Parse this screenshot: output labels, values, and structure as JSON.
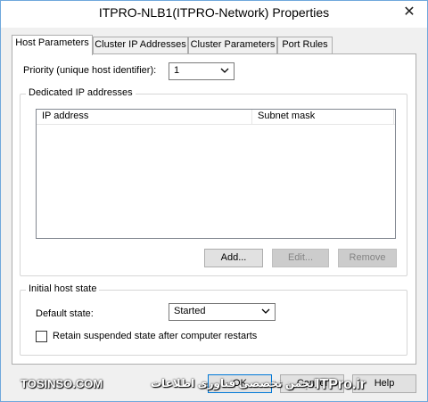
{
  "window": {
    "title": "ITPRO-NLB1(ITPRO-Network) Properties",
    "close_glyph": "✕"
  },
  "tabs": [
    {
      "label": "Host Parameters",
      "active": true
    },
    {
      "label": "Cluster IP Addresses",
      "active": false
    },
    {
      "label": "Cluster Parameters",
      "active": false
    },
    {
      "label": "Port Rules",
      "active": false
    }
  ],
  "priority": {
    "label": "Priority (unique host identifier):",
    "value": "1"
  },
  "dedicated_ip": {
    "group_title": "Dedicated IP addresses",
    "columns": [
      "IP address",
      "Subnet mask"
    ],
    "rows": [],
    "buttons": {
      "add": "Add...",
      "edit": "Edit...",
      "remove": "Remove"
    }
  },
  "initial_state": {
    "group_title": "Initial host state",
    "default_state_label": "Default state:",
    "default_state_value": "Started",
    "retain_label": "Retain suspended state after computer restarts",
    "retain_checked": false
  },
  "footer": {
    "ok": "OK",
    "cancel": "Cancel",
    "help": "Help"
  },
  "watermark": {
    "left": "TOSINSO.COM",
    "mid": "انجمن تخصصی فناوری اطلاعات",
    "right": "ITPro.ir"
  }
}
